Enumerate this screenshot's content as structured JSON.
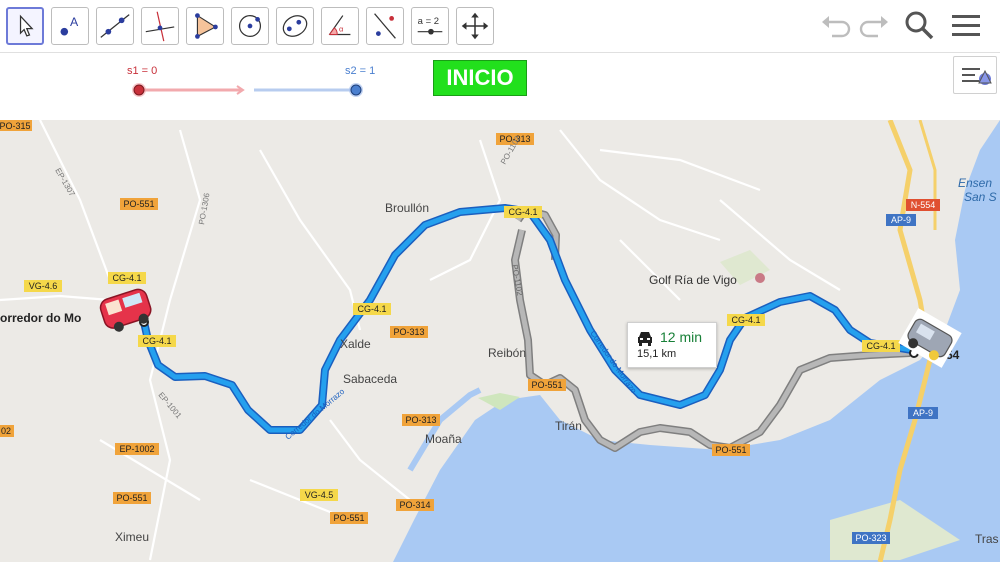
{
  "toolbar": {
    "tools": [
      {
        "name": "move-tool",
        "active": true
      },
      {
        "name": "point-tool"
      },
      {
        "name": "line-tool"
      },
      {
        "name": "perpendicular-line-tool"
      },
      {
        "name": "polygon-tool"
      },
      {
        "name": "circle-tool"
      },
      {
        "name": "ellipse-tool"
      },
      {
        "name": "angle-tool"
      },
      {
        "name": "reflect-tool"
      },
      {
        "name": "slider-tool",
        "label": "a = 2"
      },
      {
        "name": "move-graphics-view-tool"
      }
    ],
    "right": [
      "undo-icon",
      "redo-icon",
      "search-icon",
      "menu-icon"
    ]
  },
  "sliders": {
    "s1": {
      "label": "s1 = 0",
      "value": 0,
      "color": "#c8303a",
      "track": "#f2a9ad"
    },
    "s2": {
      "label": "s2 = 1",
      "value": 1,
      "color": "#4a7fcf",
      "track": "#b7ccef"
    }
  },
  "button": {
    "label": "INICIO",
    "color": "#22e01c"
  },
  "route_tooltip": {
    "time": "12 min",
    "distance": "15,1 km"
  },
  "map_labels": {
    "po315": "PO-315",
    "ep1307": "EP-1307",
    "po313a": "PO-313",
    "po1102": "PO-1102",
    "po551a": "PO-551",
    "po1306": "PO-1306",
    "broullon": "Broullón",
    "cg41a": "CG-4.1",
    "ensenada": "Ensen",
    "ensenada2": "San S",
    "n554": "N-554",
    "ap9a": "AP-9",
    "vg46": "VG-4.6",
    "cg41b": "CG-4.1",
    "corredor": "orredor do Mo",
    "golf": "Golf Ría de Vigo",
    "cg41c": "CG-4.1",
    "po313b": "PO-313",
    "cg41d": "CG-4.1",
    "xalde": "Xalde",
    "reibon": "Reibón",
    "cg41e": "CG-4.1",
    "cg41f": "CG-4.1",
    "sabaceda": "Sabaceda",
    "po551b": "PO-551",
    "ep1001": "EP-1001",
    "ap9b": "AP-9",
    "corredor2": "Corredor do Morrazo",
    "corredor3": "Corredor do Morrazo",
    "po313c": "PO-313",
    "moana": "Moaña",
    "tiran": "Tirán",
    "po551c": "PO-551",
    "ep1002": "EP-1002",
    "o2": "02",
    "vg45": "VG-4.5",
    "po551d": "PO-551",
    "po314": "PO-314",
    "po551e": "PO-551",
    "ximeu": "Ximeu",
    "po323": "PO-323",
    "tras": "Tras",
    "s4": "54"
  }
}
